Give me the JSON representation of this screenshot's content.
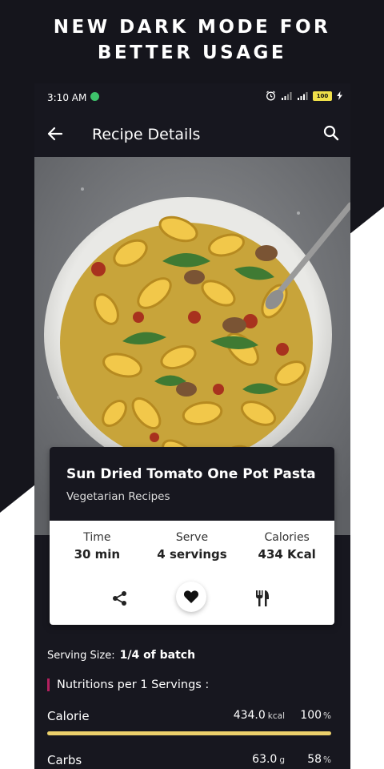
{
  "banner": {
    "line1": "NEW DARK MODE FOR",
    "line2": "BETTER USAGE"
  },
  "status_bar": {
    "time": "3:10 AM",
    "battery": "100"
  },
  "app_bar": {
    "title": "Recipe Details"
  },
  "recipe": {
    "name": "Sun Dried Tomato One Pot Pasta",
    "category": "Vegetarian Recipes",
    "stats": [
      {
        "label": "Time",
        "value": "30 min"
      },
      {
        "label": "Serve",
        "value": "4 servings"
      },
      {
        "label": "Calories",
        "value": "434 Kcal"
      }
    ]
  },
  "serving": {
    "label": "Serving Size:",
    "value": "1/4 of batch"
  },
  "nutrition": {
    "heading": "Nutritions per 1 Servings :",
    "items": [
      {
        "name": "Calorie",
        "amount": "434.0",
        "unit": "kcal",
        "percent": "100",
        "percent_unit": "%",
        "fill": 1.0
      },
      {
        "name": "Carbs",
        "amount": "63.0",
        "unit": "g",
        "percent": "58",
        "percent_unit": "%",
        "fill": 0.58
      }
    ]
  },
  "colors": {
    "accent_bar": "#ecd06b",
    "heading_marker": "#b3205f",
    "background": "#17171f"
  },
  "icons": [
    "back-arrow-icon",
    "search-icon",
    "share-icon",
    "heart-icon",
    "cutlery-icon",
    "alarm-icon",
    "signal-icon",
    "battery-icon"
  ]
}
